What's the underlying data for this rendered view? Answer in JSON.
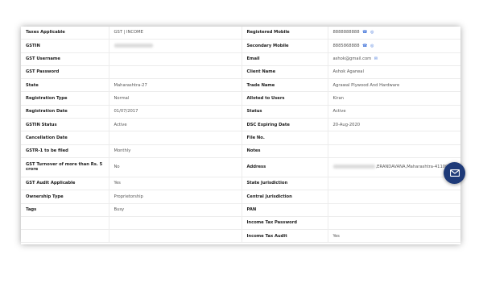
{
  "rows": [
    {
      "l1": "Taxes Applicable",
      "v1": "GST | INCOME",
      "l2": "Registered Mobile",
      "v2": "8888888888"
    },
    {
      "l1": "GSTIN",
      "v1": "",
      "l2": "Secondary Mobile",
      "v2": "8885868888"
    },
    {
      "l1": "GST Username",
      "v1": "",
      "l2": "Email",
      "v2": "ashok@gmail.com"
    },
    {
      "l1": "GST Password",
      "v1": "",
      "l2": "Client Name",
      "v2": "Ashok Agarwal"
    },
    {
      "l1": "State",
      "v1": "Maharashtra-27",
      "l2": "Trade Name",
      "v2": "Agrawal Plywood And Hardware"
    },
    {
      "l1": "Registration Type",
      "v1": "Normal",
      "l2": "Alloted to Users",
      "v2": "Kiran"
    },
    {
      "l1": "Registration Date",
      "v1": "01/07/2017",
      "l2": "Status",
      "v2": "Active"
    },
    {
      "l1": "GSTIN Status",
      "v1": "Active",
      "l2": "DSC Expiring Date",
      "v2": "20-Aug-2020"
    },
    {
      "l1": "Cancellation Date",
      "v1": "",
      "l2": "File No.",
      "v2": ""
    },
    {
      "l1": "GSTR-1 to be filed",
      "v1": "Monthly",
      "l2": "Notes",
      "v2": ""
    },
    {
      "l1": "GST Turnover of more than Rs. 5 crore",
      "v1": "No",
      "l2": "Address",
      "v2": ",ERANDAVANA,Maharashtra-411004"
    },
    {
      "l1": "GST Audit Applicable",
      "v1": "Yes",
      "l2": "State Jurisdiction",
      "v2": ""
    },
    {
      "l1": "Ownership Type",
      "v1": "Proprietorship",
      "l2": "Central Jurisdiction",
      "v2": ""
    },
    {
      "l1": "Tags",
      "v1": "Busy",
      "l2": "PAN",
      "v2": ""
    },
    {
      "l1": "",
      "v1": "",
      "l2": "Income Tax Password",
      "v2": ""
    },
    {
      "l1": "",
      "v1": "",
      "l2": "Income Tax Audit",
      "v2": "Yes"
    }
  ],
  "icons": {
    "phone": "phone-icon",
    "whatsapp": "whatsapp-icon",
    "email": "mail-icon",
    "fab": "mail-fab-icon"
  },
  "colors": {
    "fab_bg": "#1e3a78",
    "icon_blue": "#3b6fd8"
  }
}
